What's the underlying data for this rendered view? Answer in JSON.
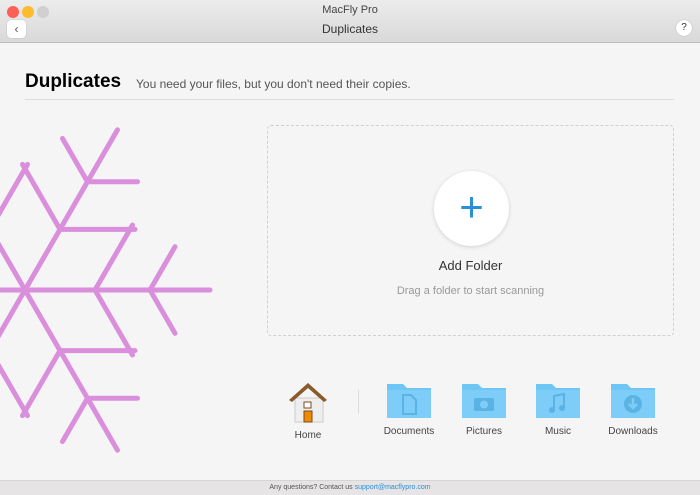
{
  "window": {
    "app_title": "MacFly Pro",
    "nav_title": "Duplicates",
    "back": "‹",
    "help": "?"
  },
  "header": {
    "title": "Duplicates",
    "subtitle": "You need your files, but you don't need their copies."
  },
  "drop_zone": {
    "plus": "+",
    "label": "Add Folder",
    "hint": "Drag a folder to start scanning"
  },
  "locations": [
    {
      "label": "Home"
    },
    {
      "label": "Documents"
    },
    {
      "label": "Pictures"
    },
    {
      "label": "Music"
    },
    {
      "label": "Downloads"
    }
  ],
  "footer": {
    "text": "Any questions? Contact us",
    "email": "support@macflypro.com"
  },
  "colors": {
    "accent": "#2a8fd6",
    "snowflake": "#d98fdc",
    "folder": "#6ec6f5"
  }
}
